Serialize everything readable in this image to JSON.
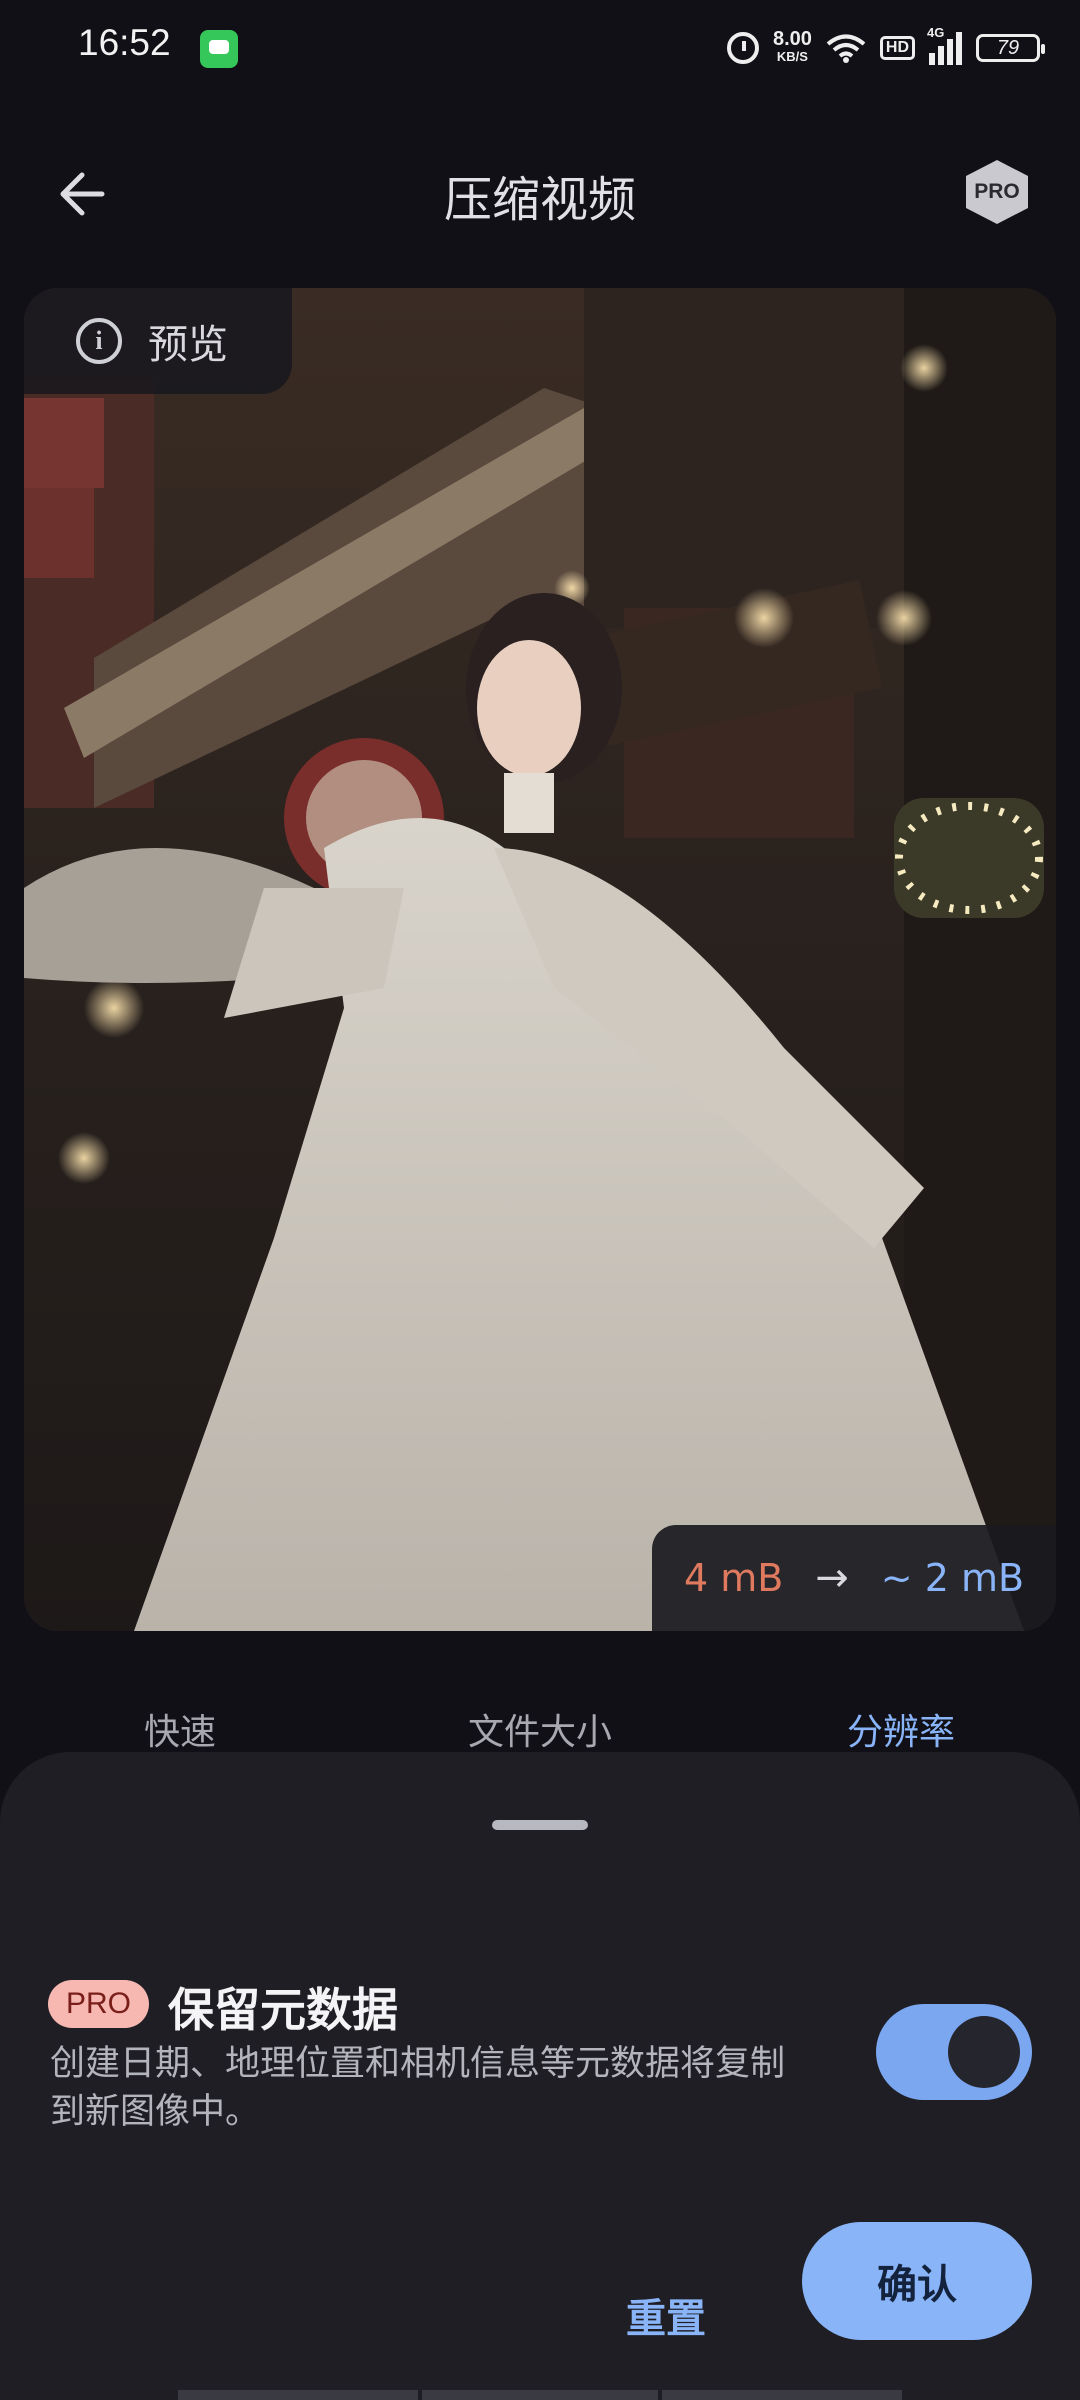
{
  "status_bar": {
    "time": "16:52",
    "net_speed": "8.00",
    "net_speed_unit": "KB/S",
    "hd_badge": "HD",
    "network_type": "4G",
    "battery": "79",
    "icons": [
      "messages-icon",
      "alarm-icon",
      "wifi-icon",
      "signal-icon",
      "battery-icon"
    ]
  },
  "header": {
    "title": "压缩视频",
    "back_icon": "arrow-left-icon",
    "pro_badge": "PRO"
  },
  "preview": {
    "label": "预览",
    "info_icon": "info-icon",
    "size_from": "4 mB",
    "size_to": "~ 2 mB",
    "arrow_icon": "arrow-right-icon"
  },
  "tabs": [
    {
      "label": "快速",
      "active": false
    },
    {
      "label": "文件大小",
      "active": false
    },
    {
      "label": "分辨率",
      "active": true
    }
  ],
  "sheet": {
    "pro_tag": "PRO",
    "title": "保留元数据",
    "description": "创建日期、地理位置和相机信息等元数据将复制到新图像中。",
    "toggle_on": true,
    "reset_label": "重置",
    "confirm_label": "确认"
  },
  "colors": {
    "background": "#101016",
    "sheet": "#1e1e24",
    "accent": "#8ab4f8",
    "size_from": "#e07a5f",
    "pro_pill": "#f7b8b2"
  }
}
